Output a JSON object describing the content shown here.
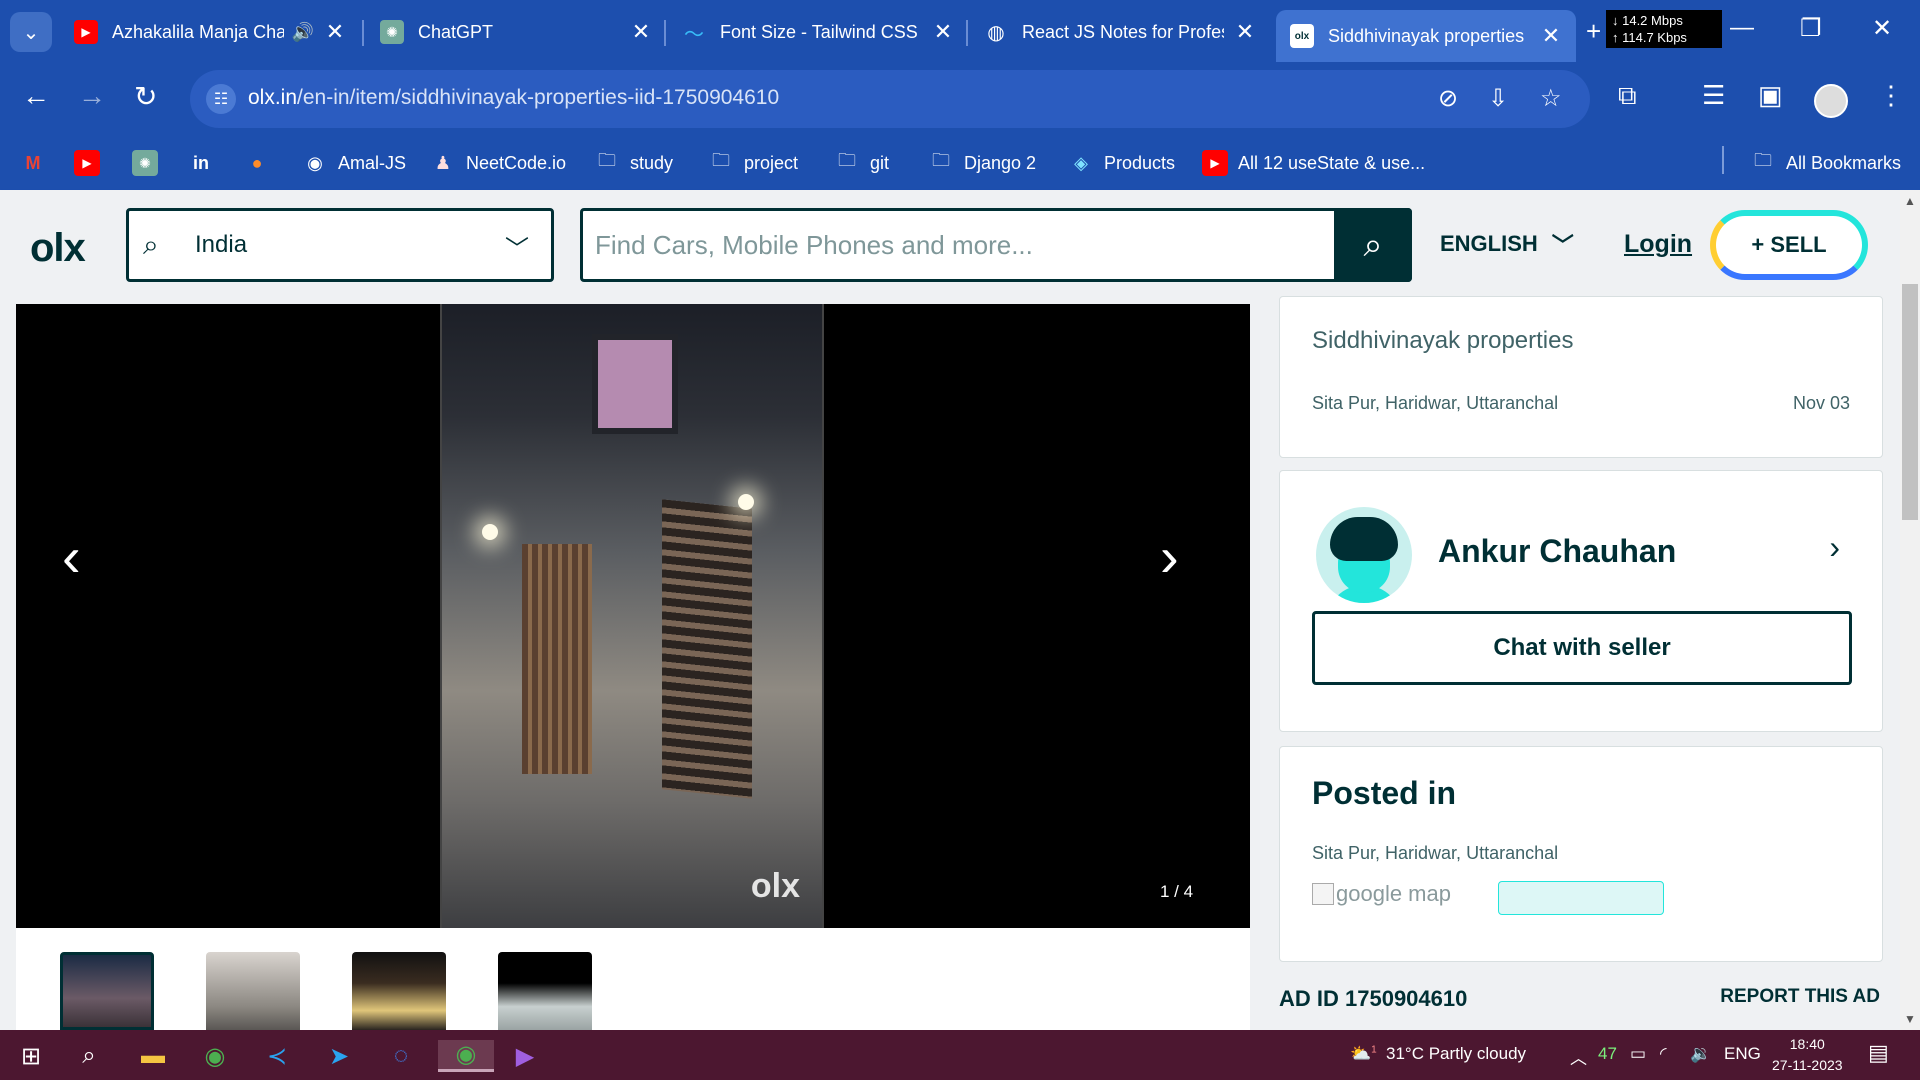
{
  "browser": {
    "tabs": [
      {
        "label": "Azhakalila Manja Cha",
        "icon": "youtube-icon",
        "audio": true
      },
      {
        "label": "ChatGPT",
        "icon": "chatgpt-icon"
      },
      {
        "label": "Font Size - Tailwind CSS",
        "icon": "tailwind-icon"
      },
      {
        "label": "React JS Notes for Profes",
        "icon": "globe-icon"
      },
      {
        "label": "Siddhivinayak properties",
        "icon": "olx-icon",
        "active": true
      }
    ],
    "netspeed": {
      "down": "↓ 14.2 Mbps",
      "up": "↑ 114.7 Kbps"
    },
    "url_host": "olx.in",
    "url_path": "/en-in/item/siddhivinayak-properties-iid-1750904610",
    "bookmarks": [
      {
        "label": "",
        "icon": "gmail-icon"
      },
      {
        "label": "",
        "icon": "youtube-icon"
      },
      {
        "label": "",
        "icon": "chatgpt-icon"
      },
      {
        "label": "",
        "icon": "linkedin-icon"
      },
      {
        "label": "",
        "icon": "fire-icon"
      },
      {
        "label": "Amal-JS",
        "icon": "github-icon"
      },
      {
        "label": "NeetCode.io",
        "icon": "rocket-icon"
      },
      {
        "label": "study",
        "icon": "folder-icon"
      },
      {
        "label": "project",
        "icon": "folder-icon"
      },
      {
        "label": "git",
        "icon": "folder-icon"
      },
      {
        "label": "Django 2",
        "icon": "folder-icon"
      },
      {
        "label": "Products",
        "icon": "products-icon"
      },
      {
        "label": "All 12 useState & use...",
        "icon": "youtube-icon"
      }
    ],
    "all_bookmarks": "All Bookmarks"
  },
  "olx": {
    "logo": "olx",
    "location_value": "India",
    "search_placeholder": "Find Cars, Mobile Phones and more...",
    "language": "ENGLISH",
    "login": "Login",
    "sell": "+ SELL"
  },
  "gallery": {
    "counter": "1 / 4",
    "watermark": "olx"
  },
  "listing": {
    "title": "Siddhivinayak properties",
    "location": "Sita Pur, Haridwar, Uttaranchal",
    "date": "Nov 03"
  },
  "seller": {
    "name": "Ankur Chauhan",
    "chat_label": "Chat with seller"
  },
  "posted": {
    "heading": "Posted in",
    "location": "Sita Pur, Haridwar, Uttaranchal",
    "map_alt": "google map"
  },
  "ad": {
    "id_text": "AD ID 1750904610",
    "report": "REPORT THIS AD"
  },
  "taskbar": {
    "weather": "31°C  Partly cloudy",
    "weather_badge": "1",
    "battery": "47",
    "lang": "ENG",
    "time": "18:40",
    "date": "27-11-2023"
  },
  "colors": {
    "browser_chrome": "#1d4fae",
    "olx_primary": "#002f34",
    "olx_teal": "#23e5db",
    "olx_yellow": "#ffce32",
    "olx_blue": "#3a77ff",
    "taskbar": "#4c1730"
  }
}
